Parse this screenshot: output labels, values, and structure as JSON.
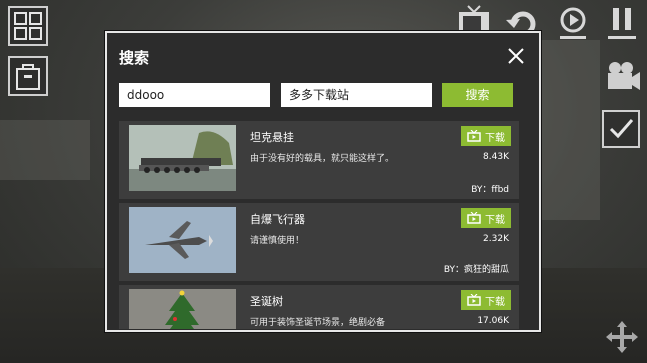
{
  "dialog": {
    "title": "搜索",
    "search_value": "ddooo",
    "source_value": "多多下载站",
    "search_button": "搜索"
  },
  "results": [
    {
      "name": "坦克悬挂",
      "desc": "由于没有好的载具，就只能这样了。",
      "download": "下载",
      "size": "8.43K",
      "author": "BY：ffbd"
    },
    {
      "name": "自爆飞行器",
      "desc": "请谨慎使用！",
      "download": "下载",
      "size": "2.32K",
      "author": "BY：疯狂的甜瓜"
    },
    {
      "name": "圣诞树",
      "desc": "可用于装饰圣诞节场景，绝剧必备",
      "download": "下载",
      "size": "17.06K",
      "author": ""
    }
  ],
  "colors": {
    "accent": "#8dbb32",
    "panel": "#2c2c2c",
    "item": "#3d3d3d"
  },
  "icons": [
    "grid-icon",
    "bag-icon",
    "tv-icon",
    "undo-icon",
    "slow-motion-icon",
    "pause-icon",
    "camera-icon",
    "checkbox-icon",
    "move-icon",
    "close-icon",
    "download-icon"
  ]
}
